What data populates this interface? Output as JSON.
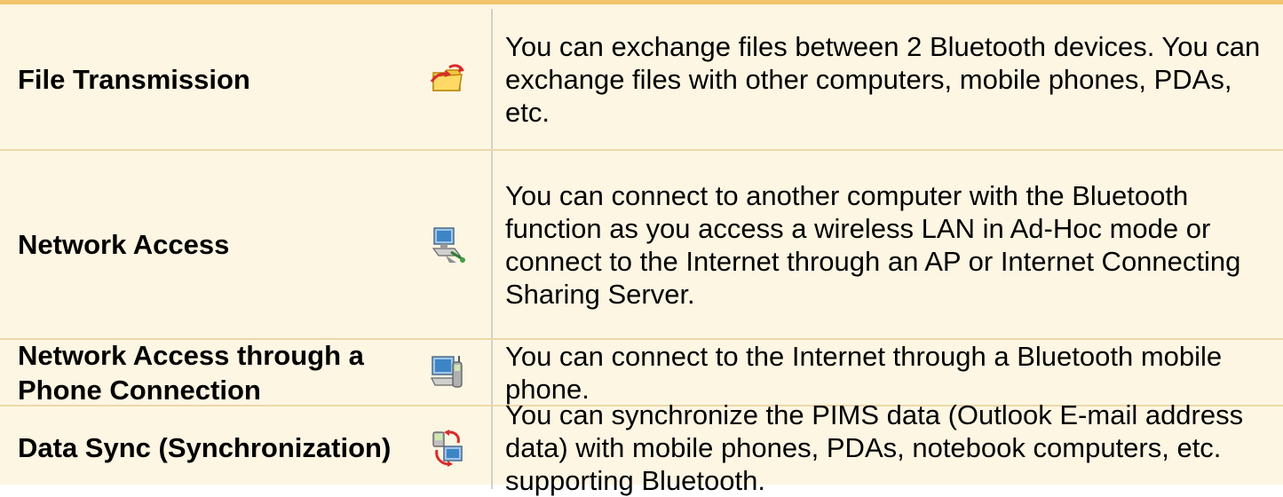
{
  "features": [
    {
      "name": "File Transmission",
      "icon": "folder-transfer-icon",
      "description": "You can exchange files between 2 Bluetooth devices. You can exchange files with other computers, mobile phones, PDAs, etc."
    },
    {
      "name": "Network Access",
      "icon": "network-computer-icon",
      "description": "You can connect to another computer with the Bluetooth function as you access a wireless LAN in Ad-Hoc mode or connect to the Internet through an AP or Internet Connecting Sharing Server."
    },
    {
      "name": "Network Access through a Phone Connection",
      "icon": "computer-phone-icon",
      "description": "You can connect to the Internet through a Bluetooth mobile phone."
    },
    {
      "name": "Data Sync (Synchronization)",
      "icon": "sync-devices-icon",
      "description": "You can synchronize the PIMS data (Outlook E-mail address data) with mobile phones, PDAs, notebook computers, etc. supporting Bluetooth."
    }
  ],
  "colors": {
    "row_background": "#fdf6e3",
    "top_border": "#f2c46b",
    "row_divider": "#ecd9a8",
    "column_divider": "#cfcfcf"
  }
}
